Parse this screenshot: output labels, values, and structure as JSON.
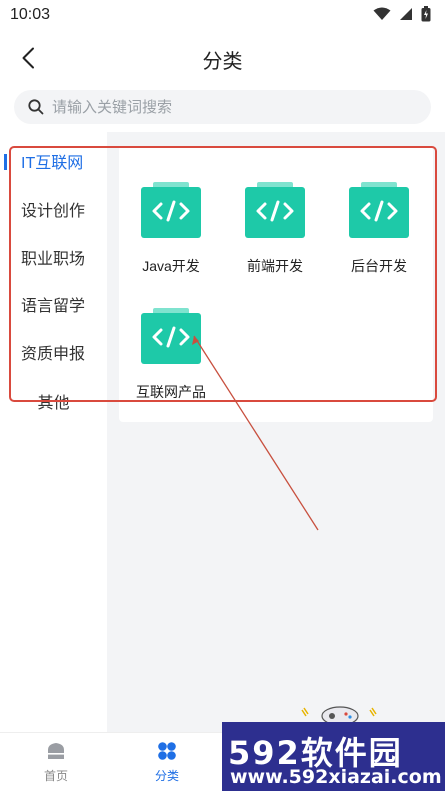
{
  "status_bar": {
    "time": "10:03"
  },
  "header": {
    "title": "分类"
  },
  "search": {
    "placeholder": "请输入关键词搜索"
  },
  "sidebar": {
    "items": [
      {
        "label": "IT互联网",
        "active": true
      },
      {
        "label": "设计创作"
      },
      {
        "label": "职业职场"
      },
      {
        "label": "语言留学"
      },
      {
        "label": "资质申报"
      },
      {
        "label": "其他"
      }
    ]
  },
  "categories": [
    {
      "label": "Java开发",
      "icon": "code-folder-icon"
    },
    {
      "label": "前端开发",
      "icon": "code-folder-icon"
    },
    {
      "label": "后台开发",
      "icon": "code-folder-icon"
    },
    {
      "label": "互联网产品",
      "icon": "code-folder-icon"
    }
  ],
  "tabbar": {
    "tabs": [
      {
        "label": "首页",
        "icon": "home-icon"
      },
      {
        "label": "分类",
        "icon": "category-icon",
        "active": true
      }
    ]
  },
  "watermark": {
    "title": "592软件园",
    "url": "www.592xiazai.com"
  },
  "colors": {
    "accent": "#1f6fe5",
    "icon_teal": "#1ec9a8",
    "highlight": "#d94a3e",
    "watermark_bg": "#2d2f8f"
  }
}
